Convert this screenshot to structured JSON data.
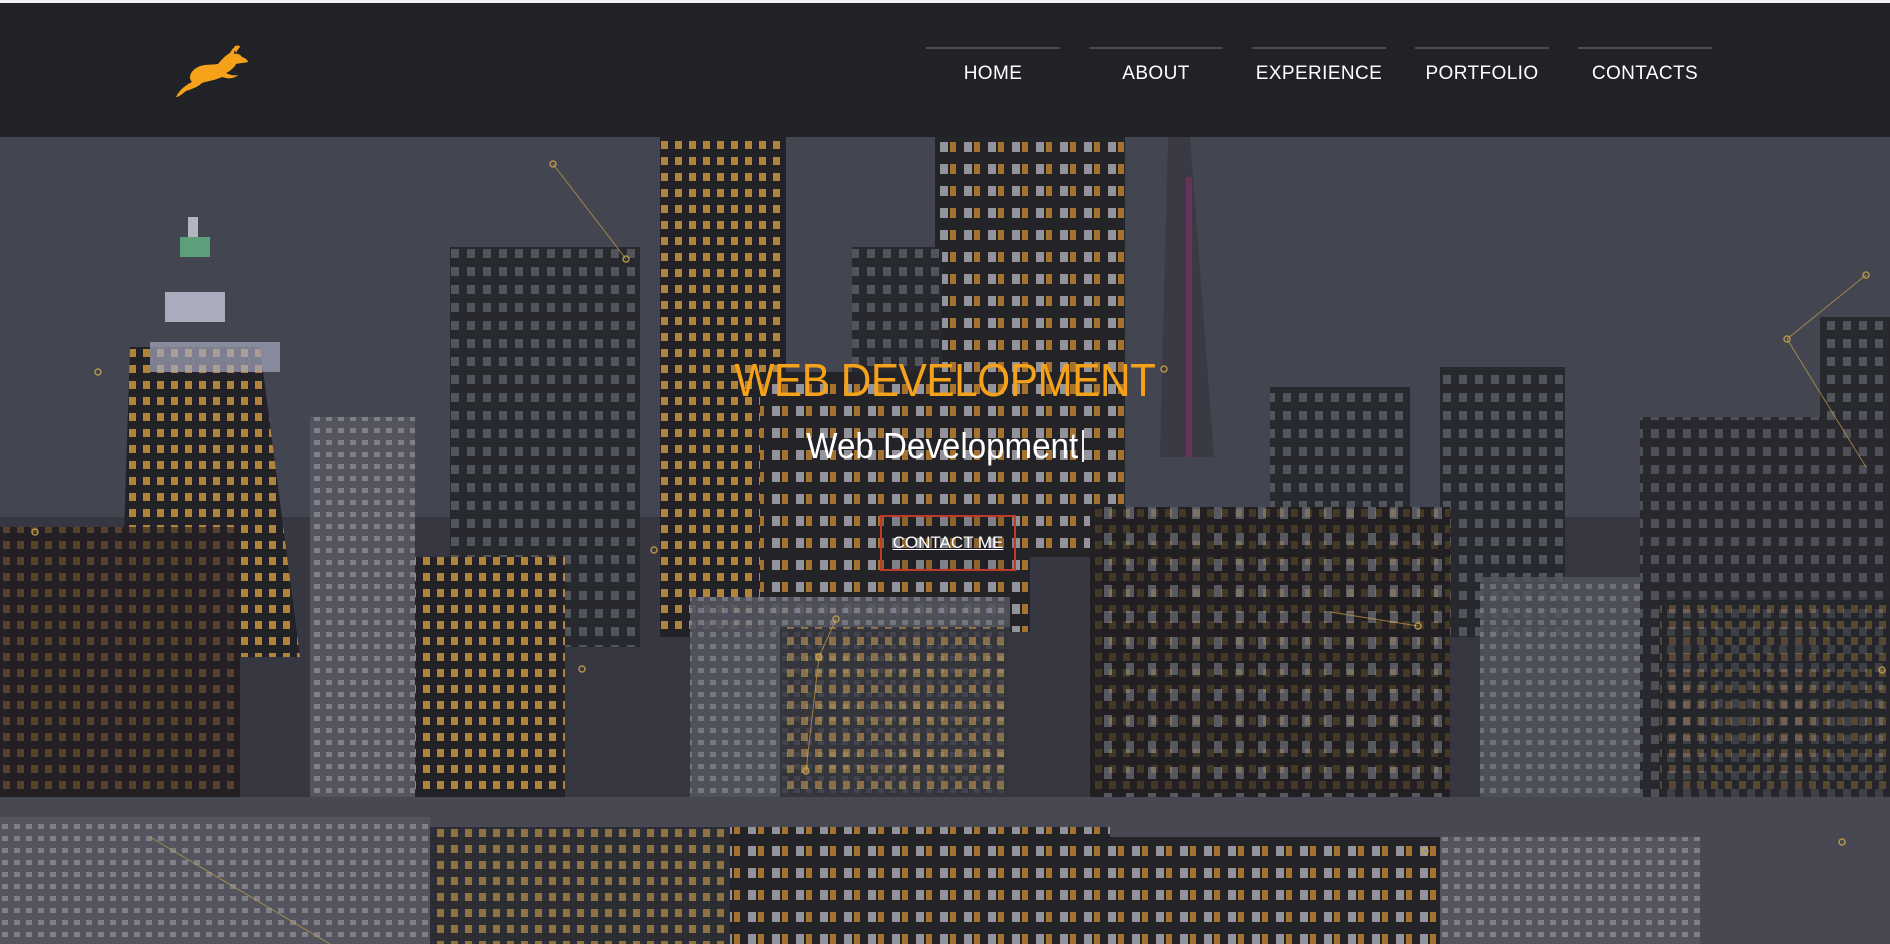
{
  "header": {
    "logo_icon": "leaping-hare-icon",
    "accent_color": "#f5a21a",
    "nav": [
      {
        "label": "HOME"
      },
      {
        "label": "ABOUT"
      },
      {
        "label": "EXPERIENCE"
      },
      {
        "label": "PORTFOLIO"
      },
      {
        "label": "CONTACTS"
      }
    ]
  },
  "hero": {
    "background": "night city skyline photo",
    "title": "WEB DEVELOPMENT",
    "subtitle": "Web Development",
    "cta_label": "CONTACT ME",
    "cta_border_color": "#c0392b"
  }
}
